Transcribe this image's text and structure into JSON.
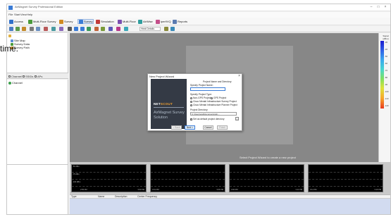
{
  "window": {
    "title": "AirMagnet Survey Professional Edition",
    "controls": [
      "–",
      "□",
      "×"
    ]
  },
  "menu": [
    "File",
    "Start",
    "View",
    "Help"
  ],
  "toolbar": {
    "buttons": [
      {
        "label": "Access",
        "icon": "access-icon",
        "color": "#2f6fc9"
      },
      {
        "label": "Multi-Floor Survey",
        "icon": "multi-floor-icon",
        "color": "#4a9a3a"
      },
      {
        "label": "Survey",
        "icon": "survey-icon",
        "color": "#d08a20"
      },
      {
        "label": "Survey",
        "icon": "survey-view-icon",
        "color": "#3a7bd5"
      },
      {
        "label": "Simulation",
        "icon": "simulation-icon",
        "color": "#c23b3b"
      },
      {
        "label": "Multi-Floor",
        "icon": "multi-floor-view-icon",
        "color": "#7a4fb0"
      },
      {
        "label": "AirWise",
        "icon": "airwise-icon",
        "color": "#2f9e9e"
      },
      {
        "label": "iperf/VQ",
        "icon": "iperf-icon",
        "color": "#c44f8a"
      },
      {
        "label": "Reports",
        "icon": "reports-icon",
        "color": "#5a7ab0"
      }
    ],
    "combo_label": "Heat Details"
  },
  "tree": {
    "items": [
      "Site Map",
      "Survey Data",
      "Survey Path"
    ]
  },
  "left_tabs": [
    "Channel",
    "SSIDs",
    "APs"
  ],
  "channel_root": "Channel",
  "legend": {
    "title": "Signal (dBm)",
    "labels": [
      "-30",
      "-40",
      "-50",
      "-60",
      "-70",
      "-80",
      "-90",
      "-100",
      "-110",
      "-120"
    ]
  },
  "hint": "Select Project Wizard to create a new project",
  "mini_charts": [
    {
      "y_labels": [
        "-50 dBm",
        "-75 dBm",
        "-100 dBm"
      ],
      "t_left": "2:55 PM",
      "t_right": "3:00 PM"
    },
    {
      "y_labels": [],
      "t_left": "3:01 PM",
      "t_right": "3:06 PM"
    },
    {
      "y_labels": [],
      "t_left": "3:06 PM",
      "t_right": "3:11 PM"
    },
    {
      "y_labels": [],
      "t_left": "3:11 PM",
      "t_right": "3:16 PM"
    }
  ],
  "grid": {
    "columns": [
      "Type",
      "Name",
      "Description",
      "Center Frequency"
    ]
  },
  "dialog": {
    "title": "New Project Wizard",
    "close": "×",
    "brand_logo_a": "NET",
    "brand_logo_b": "SCOUT",
    "brand_name": "AirMagnet Survey Solution",
    "section": "Project Name and Directory",
    "name_label": "Specify Project Name:",
    "name_value": "",
    "type_label": "Specify Project Type:",
    "radios": [
      {
        "label": "Non-GPS Project",
        "checked": true
      },
      {
        "label": "GPS Project",
        "checked": false
      },
      {
        "label": "Cisco Meraki Infrastructure Survey Project",
        "checked": false
      },
      {
        "label": "Cisco Meraki Infrastructure Planner Project",
        "checked": false
      }
    ],
    "dir_label": "Project Directory:",
    "dir_value": "C:\\Users\\gat\\Documents\\Air...",
    "browse": "...",
    "default_check": "Set as default project directory",
    "buttons": [
      {
        "label": "< Back",
        "state": "disabled"
      },
      {
        "label": "Next >",
        "state": "primary"
      },
      {
        "label": "Cancel",
        "state": "normal"
      },
      {
        "label": "Finish",
        "state": "disabled"
      }
    ]
  },
  "overlay": "time."
}
